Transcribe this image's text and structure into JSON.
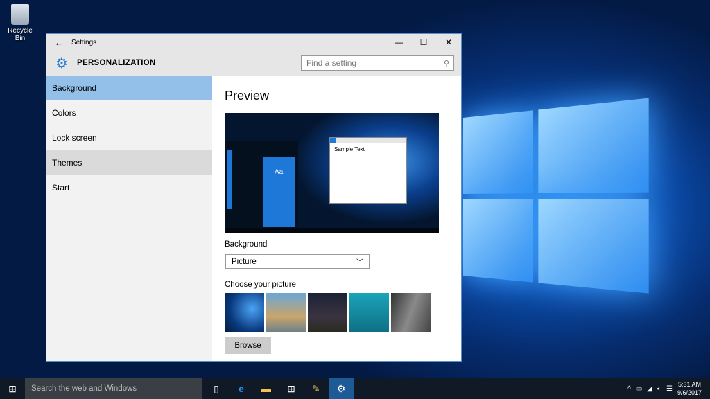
{
  "desktop": {
    "recycle_bin": "Recycle Bin"
  },
  "window": {
    "title": "Settings",
    "header": "PERSONALIZATION",
    "search_placeholder": "Find a setting"
  },
  "sidebar": {
    "items": [
      {
        "label": "Background",
        "selected": true
      },
      {
        "label": "Colors"
      },
      {
        "label": "Lock screen"
      },
      {
        "label": "Themes",
        "hovered": true
      },
      {
        "label": "Start"
      }
    ]
  },
  "main": {
    "preview_title": "Preview",
    "sample_text": "Sample Text",
    "tile_text": "Aa",
    "background_label": "Background",
    "background_value": "Picture",
    "choose_label": "Choose your picture",
    "browse": "Browse"
  },
  "taskbar": {
    "search_placeholder": "Search the web and Windows",
    "time": "5:31 AM",
    "date": "9/6/2017"
  },
  "colors": {
    "accent": "#1e78d7",
    "selected": "#93c0e8"
  }
}
